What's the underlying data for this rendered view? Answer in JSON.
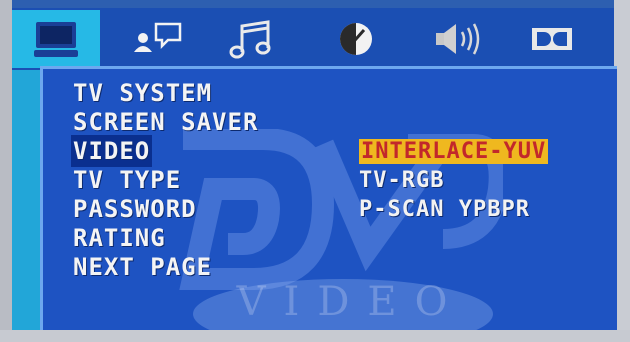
{
  "tabs": [
    {
      "name": "tab-system",
      "icon": "monitor-icon",
      "active": true
    },
    {
      "name": "tab-language",
      "icon": "speech-bubble-icon",
      "active": false
    },
    {
      "name": "tab-audio",
      "icon": "music-note-icon",
      "active": false
    },
    {
      "name": "tab-video-adjust",
      "icon": "contrast-icon",
      "active": false
    },
    {
      "name": "tab-speaker",
      "icon": "speaker-icon",
      "active": false
    },
    {
      "name": "tab-dolby",
      "icon": "dolby-icon",
      "active": false
    }
  ],
  "menu": {
    "items": [
      "TV SYSTEM",
      "SCREEN SAVER",
      "VIDEO",
      "TV TYPE",
      "PASSWORD",
      "RATING",
      "NEXT PAGE"
    ],
    "selected_index": 2
  },
  "options": {
    "items": [
      "INTERLACE-YUV",
      "TV-RGB",
      "P-SCAN YPBPR"
    ],
    "highlighted_index": 0
  },
  "watermark": {
    "text": "VIDEO"
  },
  "colors": {
    "tab_bar": "#1b4fb3",
    "active_tab": "#26b9e6",
    "panel": "#1e53c2",
    "highlight_bg": "#efb81f",
    "highlight_text": "#c2282b"
  }
}
